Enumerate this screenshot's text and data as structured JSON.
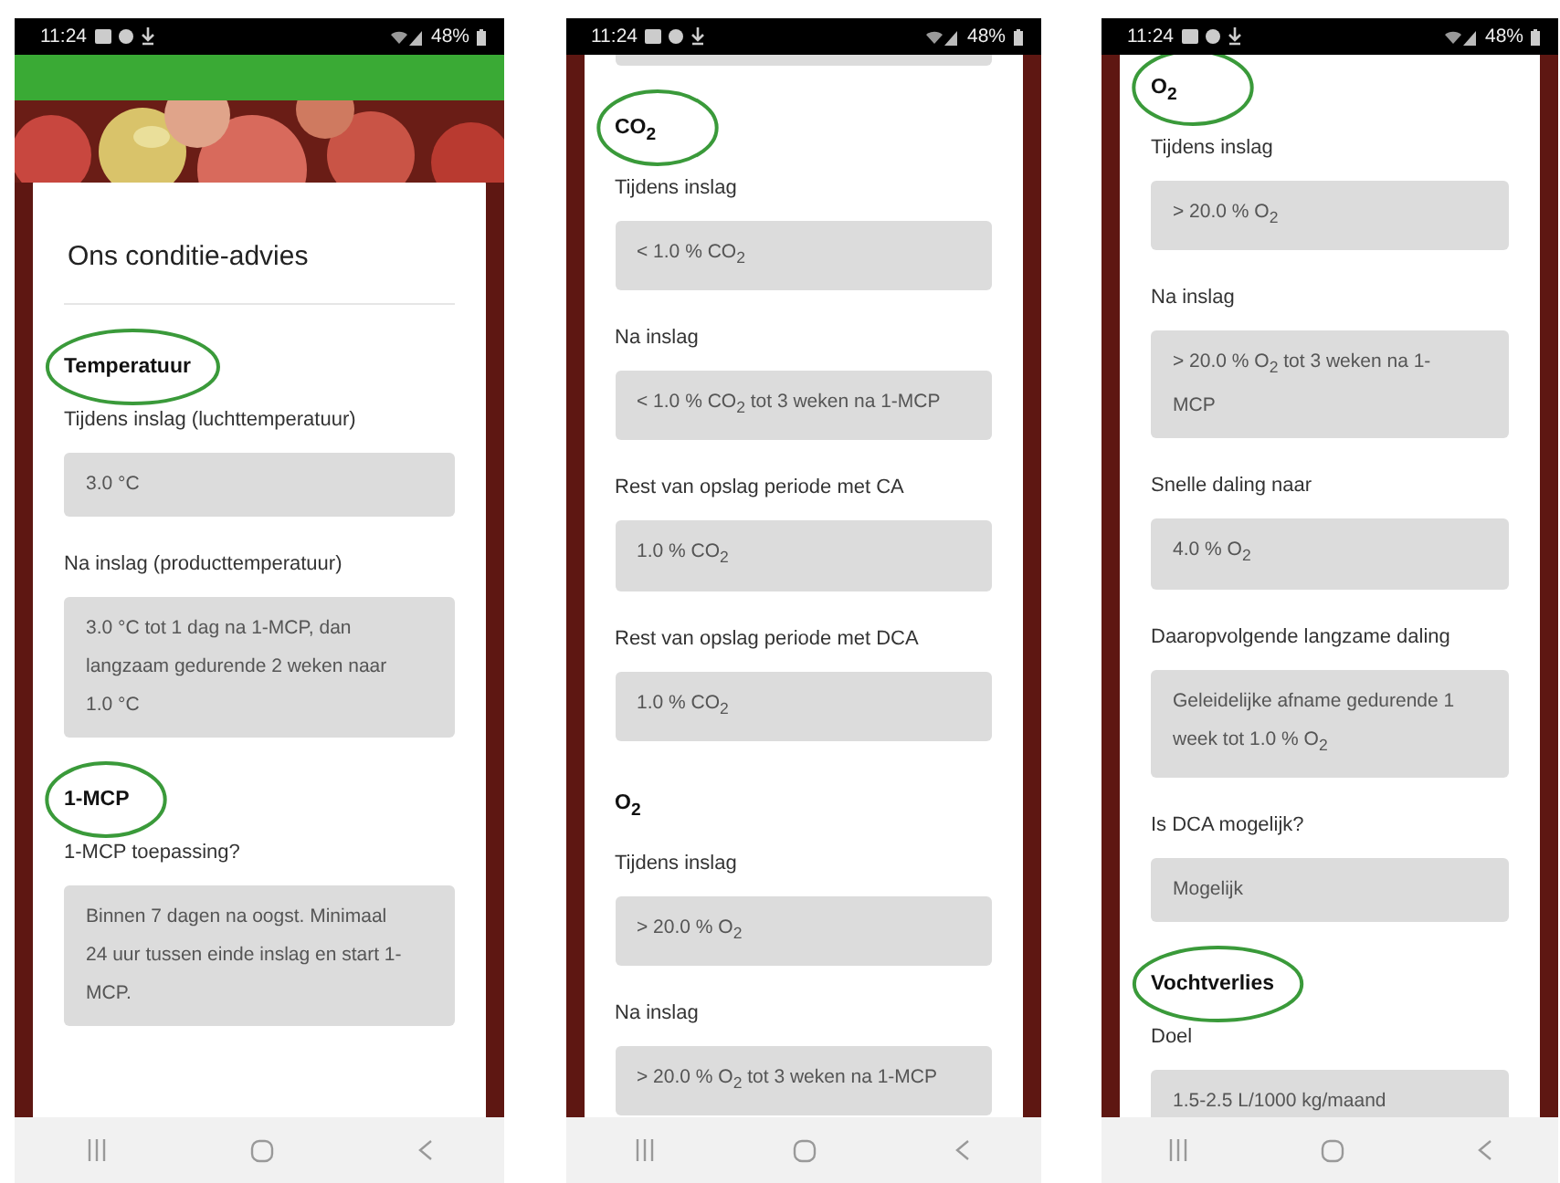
{
  "phones": [
    {
      "status": {
        "time": "11:24",
        "battery": "48%"
      },
      "app_bar": true,
      "hero": true,
      "card_title": "Ons conditie-advies",
      "top_stub": false,
      "sections": [
        {
          "heading": "Temperatuur",
          "circled": true,
          "fields": [
            {
              "label": "Tijdens inslag (luchttemperatuur)",
              "value": "3.0 °C"
            },
            {
              "label": "Na inslag (producttemperatuur)",
              "value": "3.0 °C tot 1 dag na 1-MCP, dan langzaam gedurende 2 weken naar 1.0 °C"
            }
          ]
        },
        {
          "heading": "1-MCP",
          "circled": true,
          "fields": [
            {
              "label": "1-MCP toepassing?",
              "value": "Binnen 7 dagen na oogst. Minimaal 24 uur tussen einde inslag en start 1-MCP."
            }
          ]
        }
      ]
    },
    {
      "status": {
        "time": "11:24",
        "battery": "48%"
      },
      "app_bar": false,
      "hero": false,
      "top_stub": true,
      "sections": [
        {
          "heading": "CO$_{2}$",
          "circled": true,
          "fields": [
            {
              "label": "Tijdens inslag",
              "value": "< 1.0 % CO$_{2}$"
            },
            {
              "label": "Na inslag",
              "value": "< 1.0 % CO$_{2}$ tot 3 weken na 1-MCP"
            },
            {
              "label": "Rest van opslag periode met CA",
              "value": "1.0 % CO$_{2}$"
            },
            {
              "label": "Rest van opslag periode met DCA",
              "value": "1.0 % CO$_{2}$"
            }
          ]
        },
        {
          "heading": "O$_{2}$",
          "circled": false,
          "fields": [
            {
              "label": "Tijdens inslag",
              "value": "> 20.0 % O$_{2}$"
            },
            {
              "label": "Na inslag",
              "value": "> 20.0 % O$_{2}$ tot 3 weken na 1-MCP"
            }
          ]
        }
      ]
    },
    {
      "status": {
        "time": "11:24",
        "battery": "48%"
      },
      "app_bar": false,
      "hero": false,
      "top_stub": false,
      "sections": [
        {
          "heading": "O$_{2}$",
          "circled": true,
          "fields": [
            {
              "label": "Tijdens inslag",
              "value": "> 20.0 % O$_{2}$"
            },
            {
              "label": "Na inslag",
              "value": "> 20.0 % O$_{2}$ tot 3 weken na 1-MCP"
            },
            {
              "label": "Snelle daling naar",
              "value": "4.0 % O$_{2}$"
            },
            {
              "label": "Daaropvolgende langzame daling",
              "value": "Geleidelijke afname gedurende 1 week tot 1.0 % O$_{2}$"
            },
            {
              "label": "Is DCA mogelijk?",
              "value": "Mogelijk"
            }
          ]
        },
        {
          "heading": "Vochtverlies",
          "circled": true,
          "fields": [
            {
              "label": "Doel",
              "value": "1.5-2.5 L/1000 kg/maand"
            }
          ]
        }
      ]
    }
  ]
}
